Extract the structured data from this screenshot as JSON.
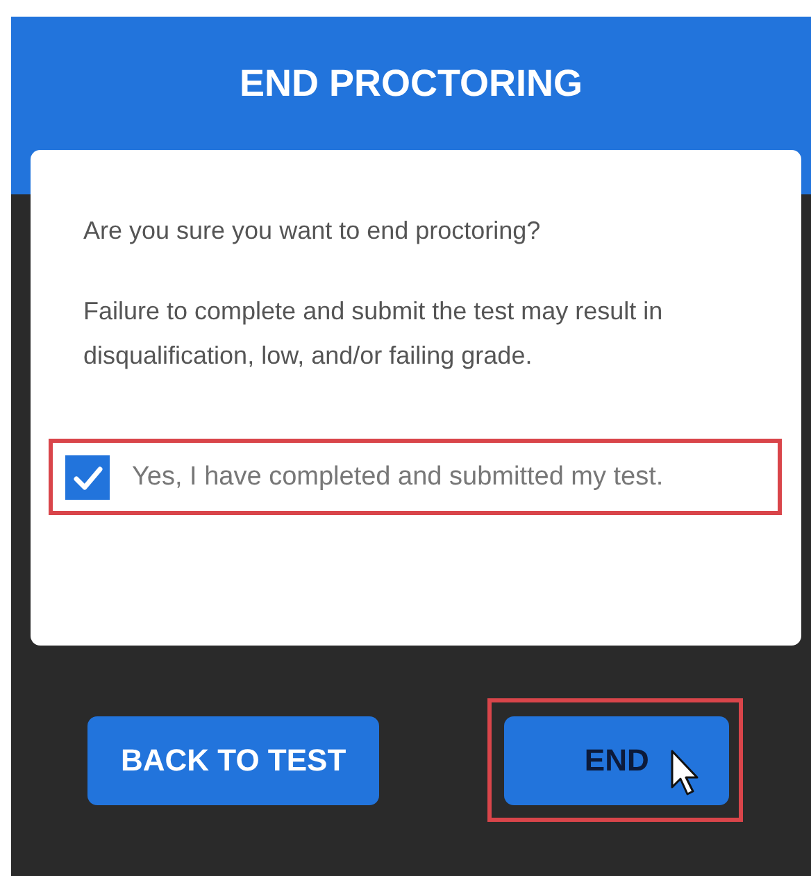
{
  "dialog": {
    "title": "END PROCTORING",
    "messages": [
      "Are you sure you want to end proctoring?",
      "Failure to complete and submit the test may result in disqualification, low, and/or failing grade."
    ],
    "confirmation": {
      "label": "Yes, I have completed and submitted my test.",
      "checked": true,
      "highlighted": true
    },
    "buttons": [
      {
        "label": "BACK TO TEST",
        "hovered": false,
        "highlighted": false
      },
      {
        "label": "END",
        "hovered": true,
        "highlighted": true
      }
    ]
  }
}
